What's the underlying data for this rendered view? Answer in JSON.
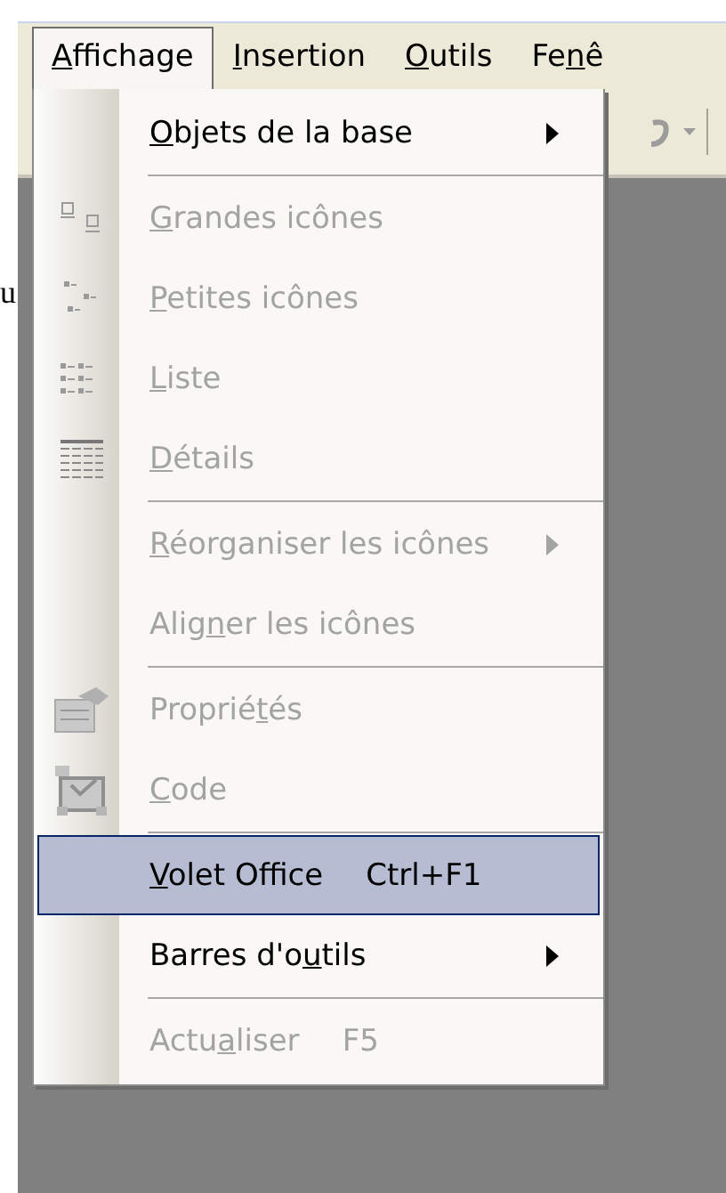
{
  "margin_text": "u",
  "menubar": [
    {
      "label": {
        "key": "A",
        "post": "ffichage"
      },
      "selected": true
    },
    {
      "label": {
        "key": "I",
        "post": "nsertion"
      },
      "selected": false
    },
    {
      "label": {
        "key": "O",
        "post": "utils"
      },
      "selected": false
    },
    {
      "label": {
        "pre": "Fe",
        "key": "n",
        "post": "ê"
      },
      "selected": false
    }
  ],
  "menu": {
    "items": [
      {
        "label": {
          "key": "O",
          "post": "bjets de la base"
        },
        "kind": "plain",
        "submenu": true,
        "disabled": false,
        "selected": false,
        "separator_after": true
      },
      {
        "label": {
          "key": "G",
          "post": "randes icônes"
        },
        "kind": "large",
        "submenu": false,
        "disabled": true,
        "selected": false,
        "separator_after": false
      },
      {
        "label": {
          "key": "P",
          "post": "etites icônes"
        },
        "kind": "small",
        "submenu": false,
        "disabled": true,
        "selected": false,
        "separator_after": false
      },
      {
        "label": {
          "key": "L",
          "post": "iste"
        },
        "kind": "list",
        "submenu": false,
        "disabled": true,
        "selected": false,
        "separator_after": false
      },
      {
        "label": {
          "key": "D",
          "post": "étails"
        },
        "kind": "details",
        "submenu": false,
        "disabled": true,
        "selected": false,
        "separator_after": true
      },
      {
        "label": {
          "key": "R",
          "post": "éorganiser les icônes"
        },
        "kind": "plain",
        "submenu": true,
        "disabled": true,
        "selected": false,
        "separator_after": false
      },
      {
        "label": {
          "pre": "Alig",
          "key": "n",
          "post": "er les icônes"
        },
        "kind": "plain",
        "submenu": false,
        "disabled": true,
        "selected": false,
        "separator_after": true
      },
      {
        "label": {
          "pre": "Proprié",
          "key": "t",
          "post": "és"
        },
        "kind": "properties",
        "submenu": false,
        "disabled": true,
        "selected": false,
        "separator_after": false
      },
      {
        "label": {
          "key": "C",
          "post": "ode"
        },
        "kind": "code",
        "submenu": false,
        "disabled": true,
        "selected": false,
        "separator_after": true
      },
      {
        "label": {
          "key": "V",
          "post": "olet Office"
        },
        "shortcut": "Ctrl+F1",
        "kind": "plain",
        "submenu": false,
        "disabled": false,
        "selected": true,
        "separator_after": false
      },
      {
        "label": {
          "pre": "Barres d'o",
          "key": "u",
          "post": "tils"
        },
        "kind": "plain",
        "submenu": true,
        "disabled": false,
        "selected": false,
        "separator_after": true
      },
      {
        "label": {
          "pre": "Actu",
          "key": "a",
          "post": "liser"
        },
        "shortcut": "F5",
        "kind": "plain",
        "submenu": false,
        "disabled": true,
        "selected": false,
        "separator_after": false
      }
    ]
  }
}
